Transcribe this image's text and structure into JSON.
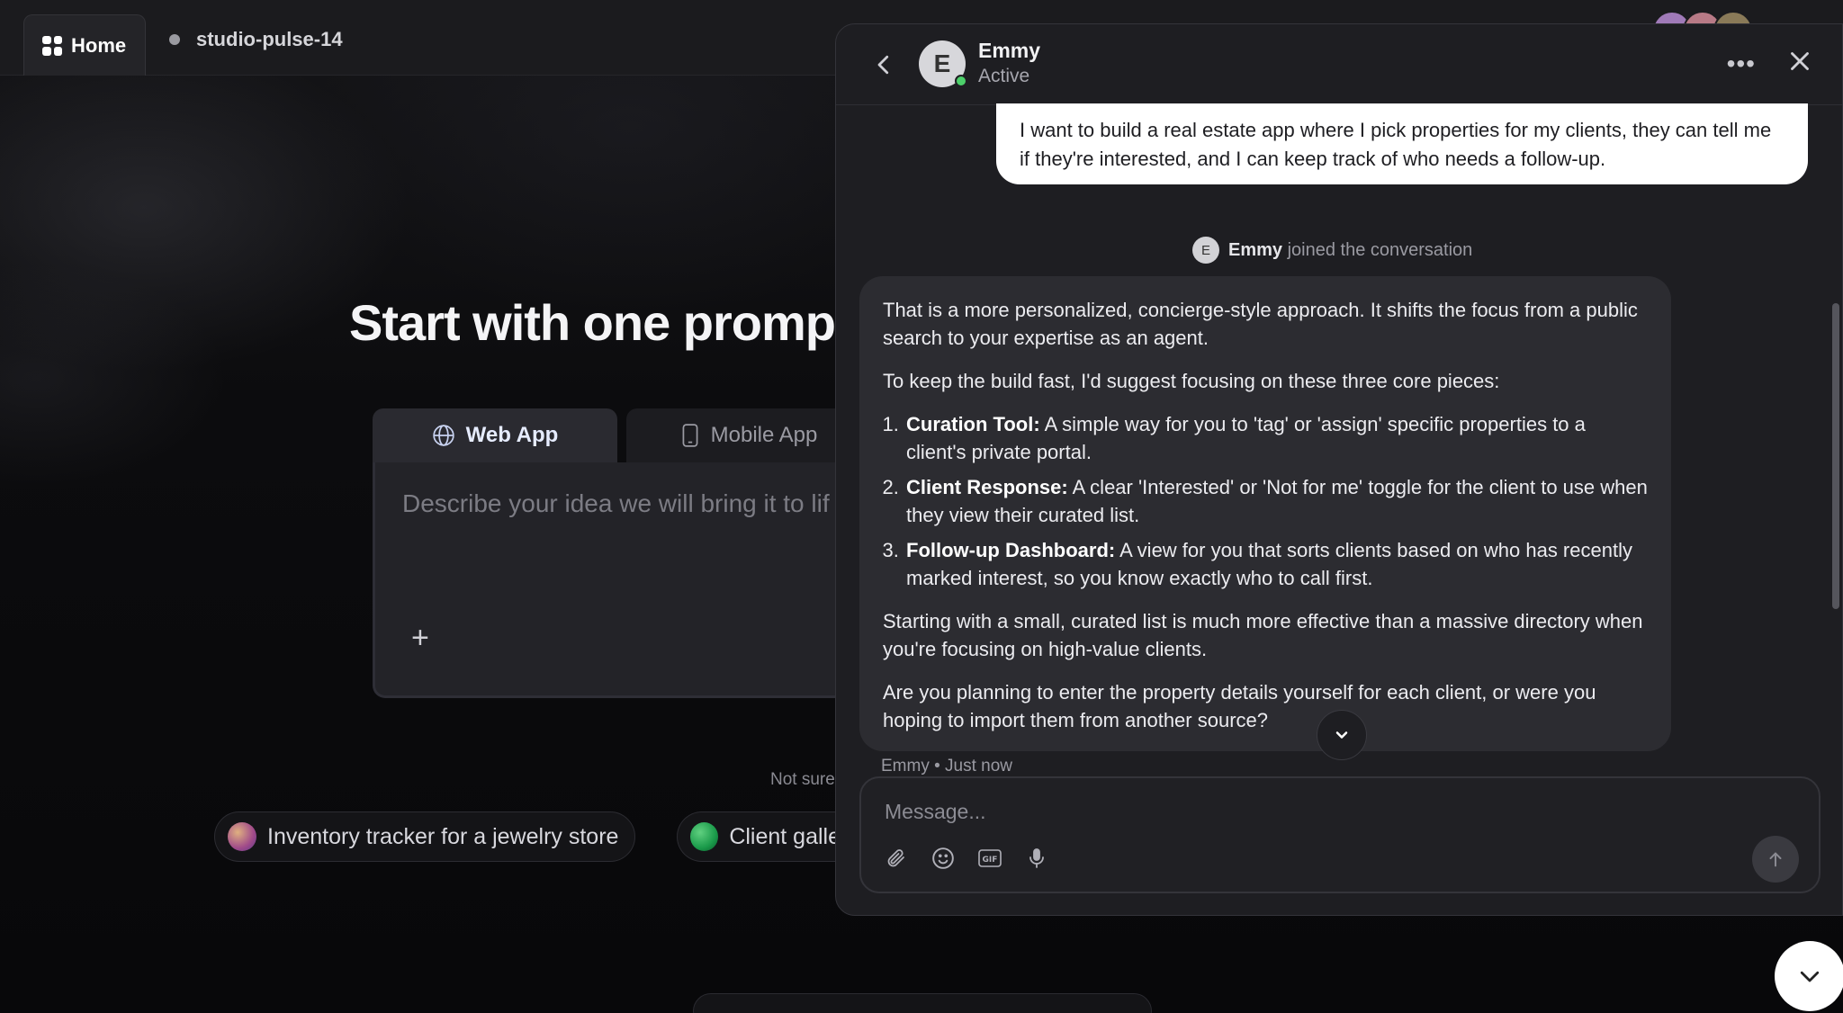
{
  "topbar": {
    "home_label": "Home",
    "project_name": "studio-pulse-14"
  },
  "hero": {
    "title": "Start with one prompt. Y",
    "tabs": [
      {
        "label": "Web App",
        "icon": "globe-icon",
        "active": true
      },
      {
        "label": "Mobile App",
        "icon": "phone-icon",
        "active": false
      }
    ],
    "placeholder": "Describe your idea we will bring it to lif",
    "not_sure_text": "Not sure",
    "chips": [
      {
        "label": "Inventory tracker for a jewelry store"
      },
      {
        "label": "Client galle"
      }
    ]
  },
  "chat": {
    "contact_name": "Emmy",
    "contact_status": "Active",
    "avatar_letter": "E",
    "user_message": "I want to build a real estate app where I pick properties for my clients, they can tell me if they're interested, and I can keep track of who needs a follow-up.",
    "join_name": "Emmy",
    "join_text": "joined the conversation",
    "bot_intro": "That is a more personalized, concierge-style approach. It shifts the focus from a public search to your expertise as an agent.",
    "bot_lead": "To keep the build fast, I'd suggest focusing on these three core pieces:",
    "bot_items": [
      {
        "title": "Curation Tool:",
        "text": "A simple way for you to 'tag' or 'assign' specific properties to a client's private portal."
      },
      {
        "title": "Client Response:",
        "text": "A clear 'Interested' or 'Not for me' toggle for the client to use when they view their curated list."
      },
      {
        "title": "Follow-up Dashboard:",
        "text": "A view for you that sorts clients based on who has recently marked interest, so you know exactly who to call first."
      }
    ],
    "bot_para2": "Starting with a small, curated list is much more effective than a massive directory when you're focusing on high-value clients.",
    "bot_question": "Are you planning to enter the property details yourself for each client, or were you hoping to import them from another source?",
    "message_meta": "Emmy • Just now",
    "input_placeholder": "Message..."
  }
}
